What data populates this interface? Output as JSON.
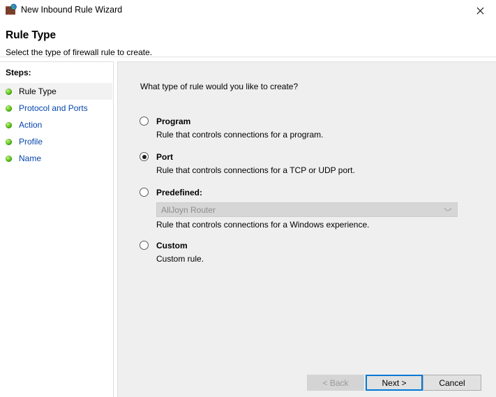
{
  "window": {
    "title": "New Inbound Rule Wizard",
    "icon": "firewall-globe-icon",
    "close_label": "×"
  },
  "header": {
    "title": "Rule Type",
    "subtitle": "Select the type of firewall rule to create."
  },
  "sidebar": {
    "label": "Steps:",
    "items": [
      {
        "label": "Rule Type",
        "current": true
      },
      {
        "label": "Protocol and Ports",
        "current": false
      },
      {
        "label": "Action",
        "current": false
      },
      {
        "label": "Profile",
        "current": false
      },
      {
        "label": "Name",
        "current": false
      }
    ]
  },
  "main": {
    "question": "What type of rule would you like to create?",
    "options": [
      {
        "id": "program",
        "title": "Program",
        "description": "Rule that controls connections for a program.",
        "selected": false
      },
      {
        "id": "port",
        "title": "Port",
        "description": "Rule that controls connections for a TCP or UDP port.",
        "selected": true
      },
      {
        "id": "predefined",
        "title": "Predefined:",
        "description": "Rule that controls connections for a Windows experience.",
        "selected": false,
        "combo_value": "AllJoyn Router",
        "combo_disabled": true
      },
      {
        "id": "custom",
        "title": "Custom",
        "description": "Custom rule.",
        "selected": false
      }
    ]
  },
  "footer": {
    "back_label": "< Back",
    "next_label": "Next >",
    "cancel_label": "Cancel"
  },
  "colors": {
    "link": "#0645ad",
    "focus": "#0078d7",
    "panel_bg": "#efefef",
    "step_bullet": "#3ea80a"
  }
}
